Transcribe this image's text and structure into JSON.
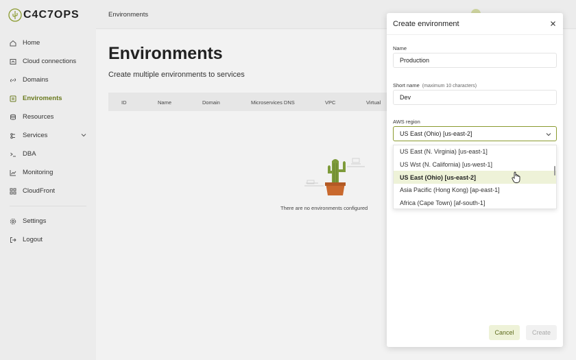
{
  "brand": {
    "name": "C4C7OPS",
    "accent": "#8a9a2e"
  },
  "sidebar": {
    "items": [
      {
        "label": "Home",
        "icon": "home-icon"
      },
      {
        "label": "Cloud connections",
        "icon": "cloud-connection-icon"
      },
      {
        "label": "Domains",
        "icon": "link-icon"
      },
      {
        "label": "Enviroments",
        "icon": "environment-icon",
        "active": true
      },
      {
        "label": "Resources",
        "icon": "database-icon"
      },
      {
        "label": "Services",
        "icon": "services-icon"
      },
      {
        "label": "DBA",
        "icon": "terminal-icon"
      },
      {
        "label": "Monitoring",
        "icon": "chart-icon"
      },
      {
        "label": "CloudFront",
        "icon": "grid-icon"
      }
    ],
    "bottom": [
      {
        "label": "Settings",
        "icon": "gear-icon"
      },
      {
        "label": "Logout",
        "icon": "logout-icon"
      }
    ]
  },
  "topbar": {
    "title": "Environments"
  },
  "main": {
    "title": "Environments",
    "subtitle": "Create multiple environments to services",
    "columns": [
      "ID",
      "Name",
      "Domain",
      "Microservices DNS",
      "VPC",
      "Virtual"
    ],
    "empty_text": "There are no environments configured"
  },
  "modal": {
    "title": "Create environment",
    "name_label": "Name",
    "name_value": "Production",
    "short_label": "Short name",
    "short_hint": "(maximum 10 characters)",
    "short_value": "Dev",
    "region_label": "AWS region",
    "region_value": "US East (Ohio) [us-east-2]",
    "region_options": [
      "US East (N. Virginia) [us-east-1]",
      "US Wst (N. California) [us-west-1]",
      "US East (Ohio) [us-east-2]",
      "Asia Pacific (Hong Kong) [ap-east-1]",
      "Africa (Cape Town) [af-south-1]"
    ],
    "cancel_label": "Cancel",
    "create_label": "Create"
  }
}
